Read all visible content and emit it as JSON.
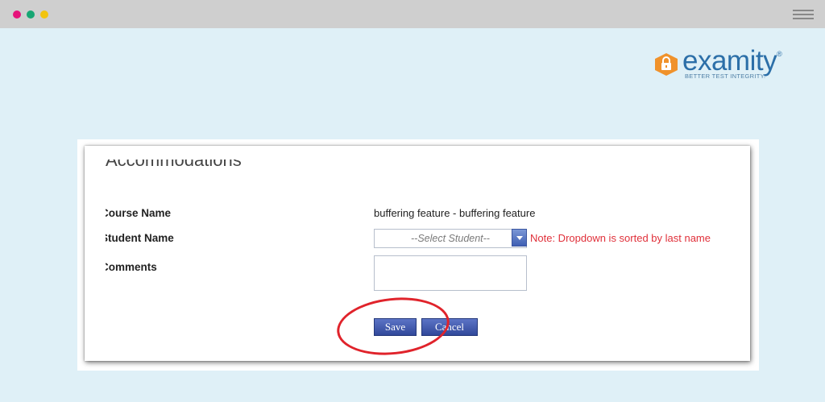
{
  "window": {
    "dots": [
      "#e6137a",
      "#17a673",
      "#f2c40f"
    ]
  },
  "logo": {
    "name": "examity",
    "mark": "®",
    "tagline": "BETTER TEST INTEGRITY."
  },
  "form": {
    "title": "Accommodations",
    "fields": {
      "course": {
        "label": "Course Name",
        "value": "buffering feature - buffering feature"
      },
      "student": {
        "label": "Student Name",
        "placeholder": "--Select Student--",
        "note": "Note: Dropdown is sorted by last name"
      },
      "comments": {
        "label": "Comments",
        "value": ""
      }
    },
    "buttons": {
      "save": "Save",
      "cancel": "Cancel"
    }
  },
  "colors": {
    "background": "#dff0f7",
    "brand": "#2c6fa8",
    "note": "#e0303a",
    "highlight_circle": "#e0232b"
  }
}
